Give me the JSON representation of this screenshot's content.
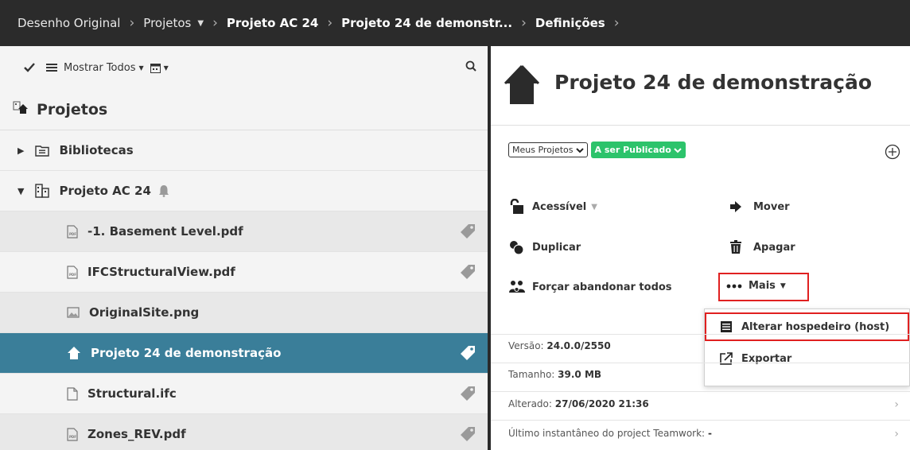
{
  "breadcrumb": {
    "items": [
      "Desenho Original",
      "Projetos",
      "Projeto AC 24",
      "Projeto 24 de demonstr...",
      "Definições"
    ]
  },
  "toolbar": {
    "show_all_label": "Mostrar Todos"
  },
  "tree": {
    "root_label": "Projetos",
    "items": [
      {
        "label": "Bibliotecas",
        "icon": "library-folder-icon"
      },
      {
        "label": "Projeto AC 24",
        "icon": "building-icon"
      },
      {
        "label": "-1. Basement Level.pdf",
        "icon": "pdf-file-icon"
      },
      {
        "label": "IFCStructuralView.pdf",
        "icon": "pdf-file-icon"
      },
      {
        "label": "OriginalSite.png",
        "icon": "image-file-icon"
      },
      {
        "label": "Projeto 24 de demonstração",
        "icon": "house-icon"
      },
      {
        "label": "Structural.ifc",
        "icon": "file-icon"
      },
      {
        "label": "Zones_REV.pdf",
        "icon": "pdf-file-icon"
      }
    ]
  },
  "detail": {
    "title": "Projeto 24 de demonstração",
    "scope_select": "Meus Projetos",
    "status_badge": "A ser Publicado",
    "actions": {
      "accessible": "Acessível",
      "move": "Mover",
      "duplicate": "Duplicar",
      "delete": "Apagar",
      "force_leave": "Forçar abandonar todos",
      "more": "Mais"
    },
    "menu": {
      "change_host": "Alterar hospedeiro (host)",
      "export": "Exportar"
    },
    "info": {
      "version_label": "Versão:",
      "version_value": "24.0.0/2550",
      "size_label": "Tamanho:",
      "size_value": "39.0 MB",
      "modified_label": "Alterado:",
      "modified_value": "27/06/2020 21:36",
      "snapshot_label": "Último instantâneo do project Teamwork:",
      "snapshot_value": "-"
    }
  },
  "colors": {
    "topbar": "#2b2b2b",
    "selected_row": "#3a7e99",
    "badge_green": "#2cc36b",
    "highlight_red": "#e02020"
  }
}
